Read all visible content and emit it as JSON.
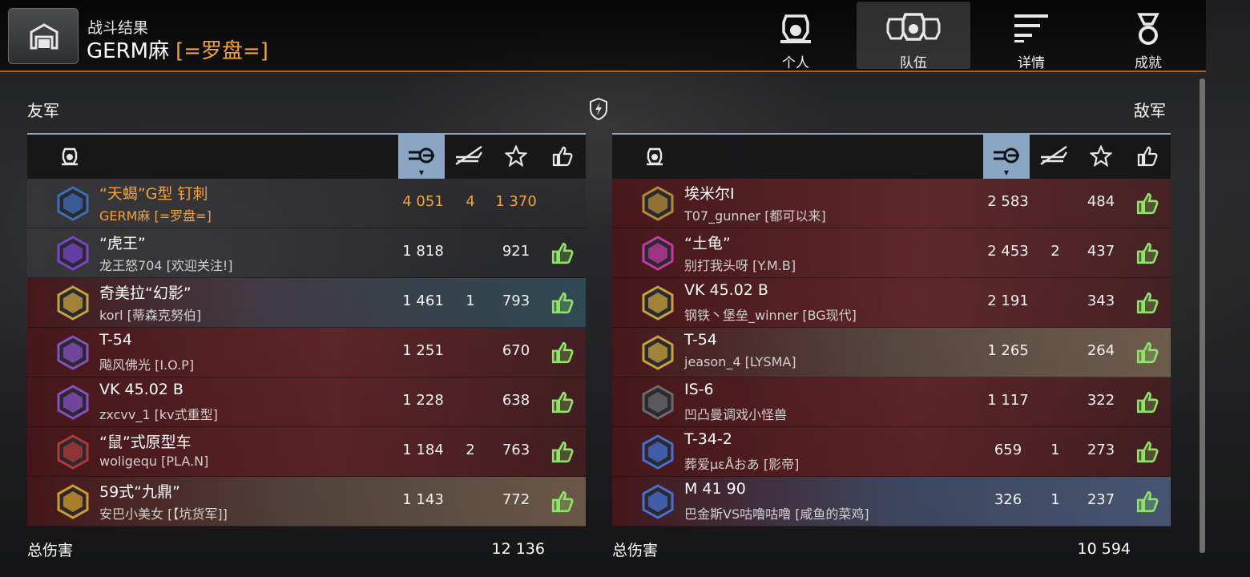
{
  "header": {
    "subtitle": "战斗结果",
    "player_name": "GERM麻",
    "clan_tag": "[=罗盘=]",
    "tabs": [
      {
        "label": "个人",
        "icon": "personal-tank-icon",
        "active": false
      },
      {
        "label": "队伍",
        "icon": "team-tanks-icon",
        "active": true
      },
      {
        "label": "详情",
        "icon": "details-list-icon",
        "active": false
      },
      {
        "label": "成就",
        "icon": "medal-icon",
        "active": false
      }
    ]
  },
  "allies": {
    "title": "友军",
    "columns": [
      "tank-icon",
      "damage-icon",
      "kills-icon",
      "xp-star-icon",
      "like-icon"
    ],
    "sorted_column": "damage-icon",
    "rows": [
      {
        "tank": "“天蝎”G型 钉刺",
        "player": "GERM麻 [=罗盘=]",
        "damage": "4 051",
        "kills": "4",
        "xp": "1 370",
        "liked": false,
        "me": true
      },
      {
        "tank": "“虎王”",
        "player": "龙王怒704 [欢迎关注!]",
        "damage": "1 818",
        "kills": "",
        "xp": "921",
        "liked": true
      },
      {
        "tank": "奇美拉“幻影”",
        "player": "korl [蒂森克努伯]",
        "damage": "1 461",
        "kills": "1",
        "xp": "793",
        "liked": true
      },
      {
        "tank": "T-54",
        "player": "飚风佛光 [I.O.P]",
        "damage": "1 251",
        "kills": "",
        "xp": "670",
        "liked": true
      },
      {
        "tank": "VK 45.02 B",
        "player": "zxcvv_1 [kv式重型]",
        "damage": "1 228",
        "kills": "",
        "xp": "638",
        "liked": true
      },
      {
        "tank": "“鼠”式原型车",
        "player": "woligequ [PLA.N]",
        "damage": "1 184",
        "kills": "2",
        "xp": "763",
        "liked": true
      },
      {
        "tank": "59式“九鼎”",
        "player": "安巴小美女 [【坑货军]]",
        "damage": "1 143",
        "kills": "",
        "xp": "772",
        "liked": true
      }
    ],
    "total_label": "总伤害",
    "total_damage": "12 136"
  },
  "enemies": {
    "title": "敌军",
    "columns": [
      "tank-icon",
      "damage-icon",
      "kills-icon",
      "xp-star-icon",
      "like-icon"
    ],
    "sorted_column": "damage-icon",
    "rows": [
      {
        "tank": "埃米尔I",
        "player": "T07_gunner [都可以来]",
        "damage": "2 583",
        "kills": "",
        "xp": "484",
        "liked": true
      },
      {
        "tank": "“土龟”",
        "player": "别打我头呀 [Y.M.B]",
        "damage": "2 453",
        "kills": "2",
        "xp": "437",
        "liked": true
      },
      {
        "tank": "VK 45.02 B",
        "player": "钢铁丶堡垒_winner [BG现代]",
        "damage": "2 191",
        "kills": "",
        "xp": "343",
        "liked": true
      },
      {
        "tank": "T-54",
        "player": "jeason_4 [LYSMA]",
        "damage": "1 265",
        "kills": "",
        "xp": "264",
        "liked": true
      },
      {
        "tank": "IS-6",
        "player": "凹凸曼调戏小怪兽",
        "damage": "1 117",
        "kills": "",
        "xp": "322",
        "liked": true
      },
      {
        "tank": "T-34-2",
        "player": "葬爱μεÅおあ [影帝]",
        "damage": "659",
        "kills": "1",
        "xp": "273",
        "liked": true
      },
      {
        "tank": "M 41 90",
        "player": "巴金斯VS咕噜咕噜 [咸鱼的菜鸡]",
        "damage": "326",
        "kills": "1",
        "xp": "237",
        "liked": true
      }
    ],
    "total_label": "总伤害",
    "total_damage": "10 594"
  },
  "colors": {
    "accent_orange": "#f4a23a",
    "header_highlight": "#8aa6c2",
    "like_green": "#8fe36b",
    "row_red": "#6e2428"
  }
}
